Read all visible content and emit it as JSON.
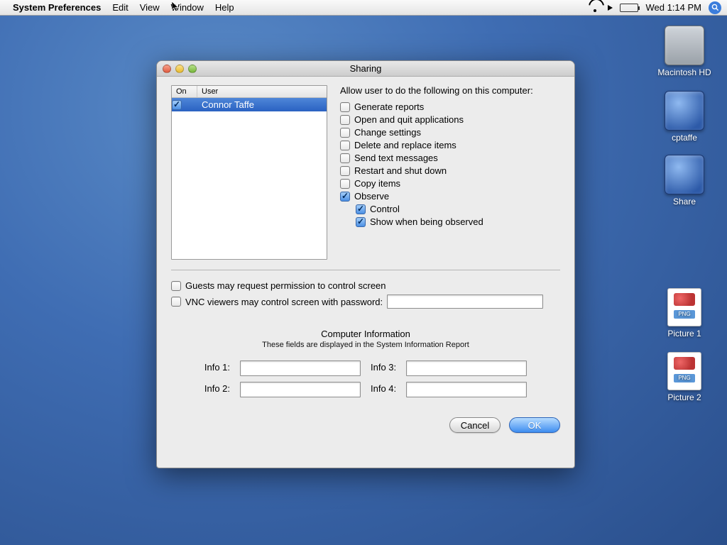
{
  "menubar": {
    "app": "System Preferences",
    "items": [
      "Edit",
      "View",
      "Window",
      "Help"
    ],
    "clock": "Wed 1:14 PM"
  },
  "desktop": {
    "hd": "Macintosh HD",
    "net1": "cptaffe",
    "net2": "Share",
    "pic1": "Picture 1",
    "pic2": "Picture 2",
    "png_tag": "PNG"
  },
  "window": {
    "title": "Sharing",
    "userlist": {
      "col_on": "On",
      "col_user": "User",
      "rows": [
        {
          "on": true,
          "name": "Connor Taffe"
        }
      ]
    },
    "perms": {
      "heading": "Allow user to do the following on this computer:",
      "items": [
        {
          "label": "Generate reports",
          "checked": false
        },
        {
          "label": "Open and quit applications",
          "checked": false
        },
        {
          "label": "Change settings",
          "checked": false
        },
        {
          "label": "Delete and replace items",
          "checked": false
        },
        {
          "label": "Send text messages",
          "checked": false
        },
        {
          "label": "Restart and shut down",
          "checked": false
        },
        {
          "label": "Copy items",
          "checked": false
        },
        {
          "label": "Observe",
          "checked": true
        }
      ],
      "observe_children": [
        {
          "label": "Control",
          "checked": true
        },
        {
          "label": "Show when being observed",
          "checked": true
        }
      ]
    },
    "lower": {
      "guests": {
        "label": "Guests may request permission to control screen",
        "checked": false
      },
      "vnc": {
        "label": "VNC viewers may control screen with password:",
        "checked": false,
        "value": ""
      }
    },
    "compinfo": {
      "heading": "Computer Information",
      "sub": "These fields are displayed in the System Information Report",
      "fields": {
        "i1": "Info 1:",
        "i2": "Info 2:",
        "i3": "Info 3:",
        "i4": "Info 4:"
      },
      "values": {
        "i1": "",
        "i2": "",
        "i3": "",
        "i4": ""
      }
    },
    "buttons": {
      "cancel": "Cancel",
      "ok": "OK"
    }
  }
}
